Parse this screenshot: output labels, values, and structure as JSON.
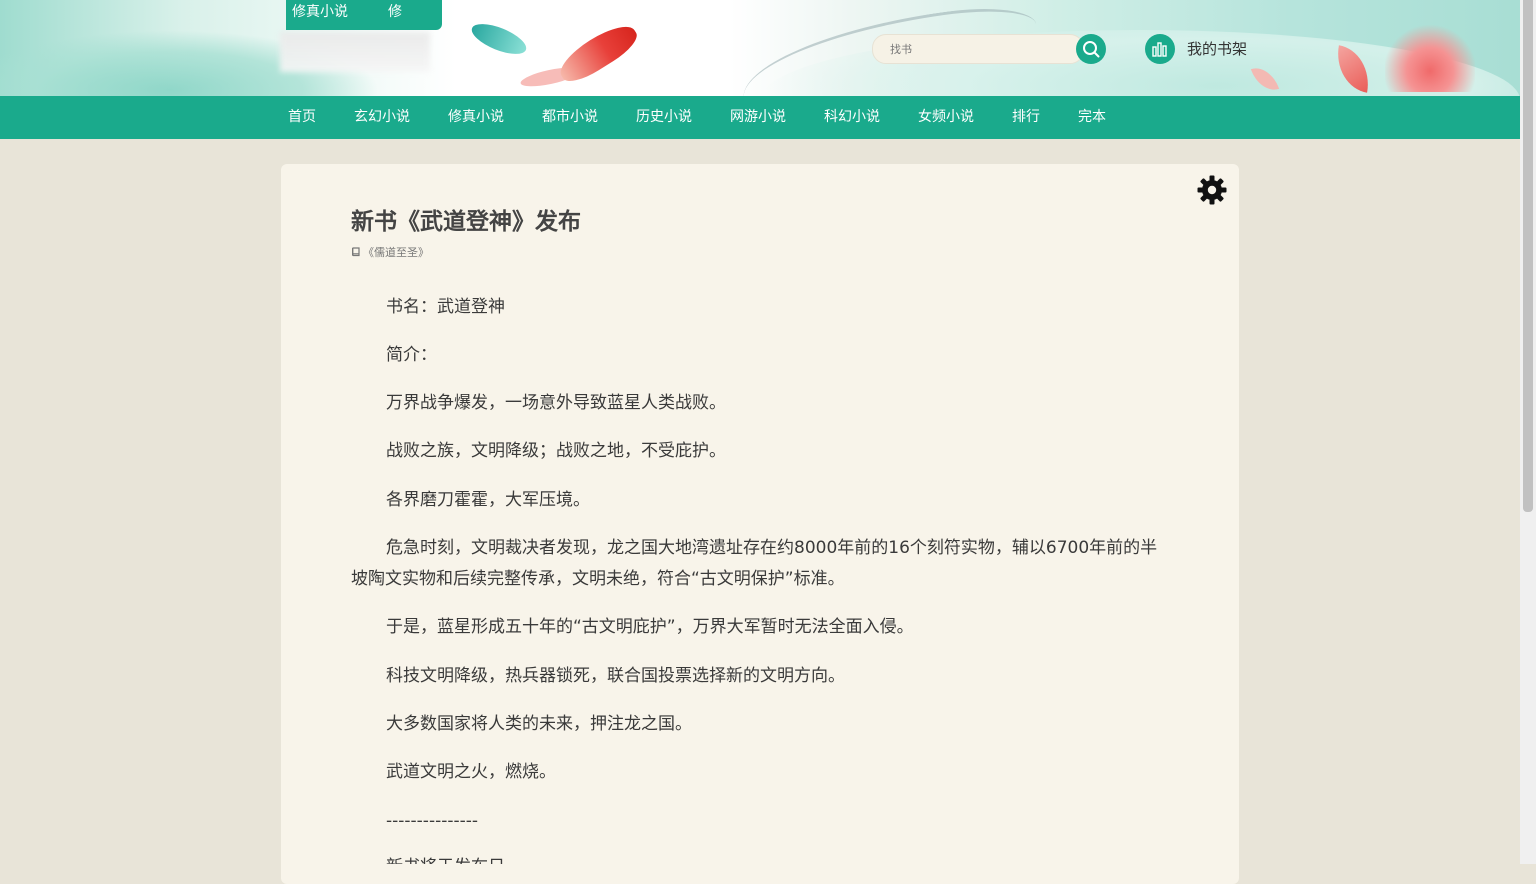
{
  "header": {
    "logo_tab_text": "修真小说",
    "logo_tab_text_b": "修",
    "search_placeholder": "找书",
    "bookshelf_label": "我的书架"
  },
  "nav": {
    "items": [
      "首页",
      "玄幻小说",
      "修真小说",
      "都市小说",
      "历史小说",
      "网游小说",
      "科幻小说",
      "女频小说",
      "排行",
      "完本"
    ]
  },
  "article": {
    "title": "新书《武道登神》发布",
    "source_book": "《儒道至圣》",
    "paragraphs": [
      "书名：武道登神",
      "简介：",
      "万界战争爆发，一场意外导致蓝星人类战败。",
      "战败之族，文明降级；战败之地，不受庇护。",
      "各界磨刀霍霍，大军压境。",
      "危急时刻，文明裁决者发现，龙之国大地湾遗址存在约8000年前的16个刻符实物，辅以6700年前的半坡陶文实物和后续完整传承，文明未绝，符合“古文明保护”标准。",
      "于是，蓝星形成五十年的“古文明庇护”，万界大军暂时无法全面入侵。",
      "科技文明降级，热兵器锁死，联合国投票选择新的文明方向。",
      "大多数国家将人类的未来，押注龙之国。",
      "武道文明之火，燃烧。",
      "---------------",
      "新书将于发布日"
    ]
  },
  "colors": {
    "accent": "#1aaa8c",
    "page_bg": "#e8e4d8",
    "card_bg": "#f8f4ea"
  },
  "icons": {
    "search": "search-icon",
    "bookshelf": "bookshelf-icon",
    "settings": "gear-icon",
    "book": "book-icon"
  }
}
